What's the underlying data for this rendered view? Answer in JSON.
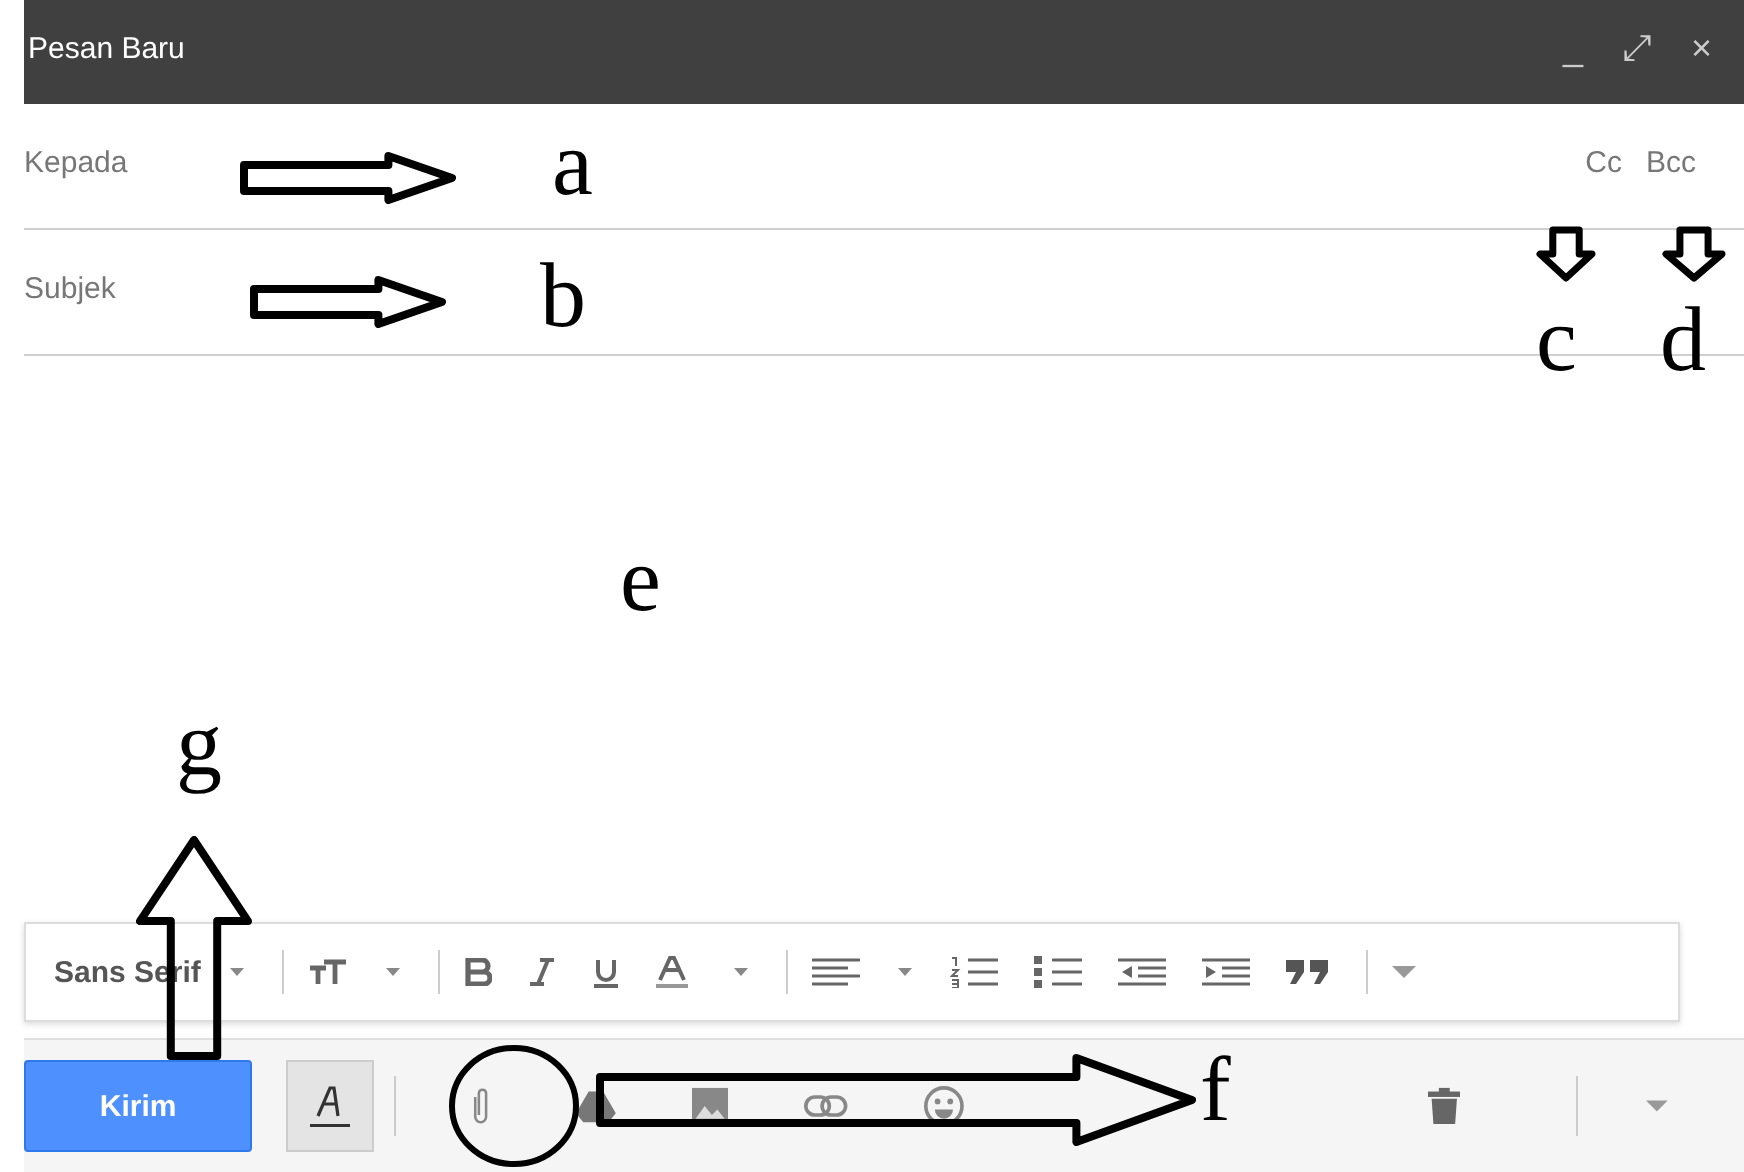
{
  "window": {
    "title": "Pesan Baru",
    "controls": [
      "_",
      "⤢",
      "×"
    ]
  },
  "fields": [
    {
      "placeholder": "Kepada",
      "links": [
        "Cc",
        "Bcc"
      ]
    },
    {
      "placeholder": "Subjek"
    }
  ],
  "format_toolbar": {
    "font": "Sans Serif"
  },
  "bottom_bar": {
    "send": "Kirim",
    "formatting_on": true
  },
  "annotations": [
    {
      "label": "a",
      "kind": "right"
    },
    {
      "label": "b",
      "kind": "right"
    },
    {
      "label": "c",
      "kind": "down"
    },
    {
      "label": "d",
      "kind": "down"
    },
    {
      "label": "e",
      "kind": "plain"
    },
    {
      "label": "f",
      "kind": "right",
      "circle": true
    },
    {
      "label": "g",
      "kind": "up"
    }
  ]
}
